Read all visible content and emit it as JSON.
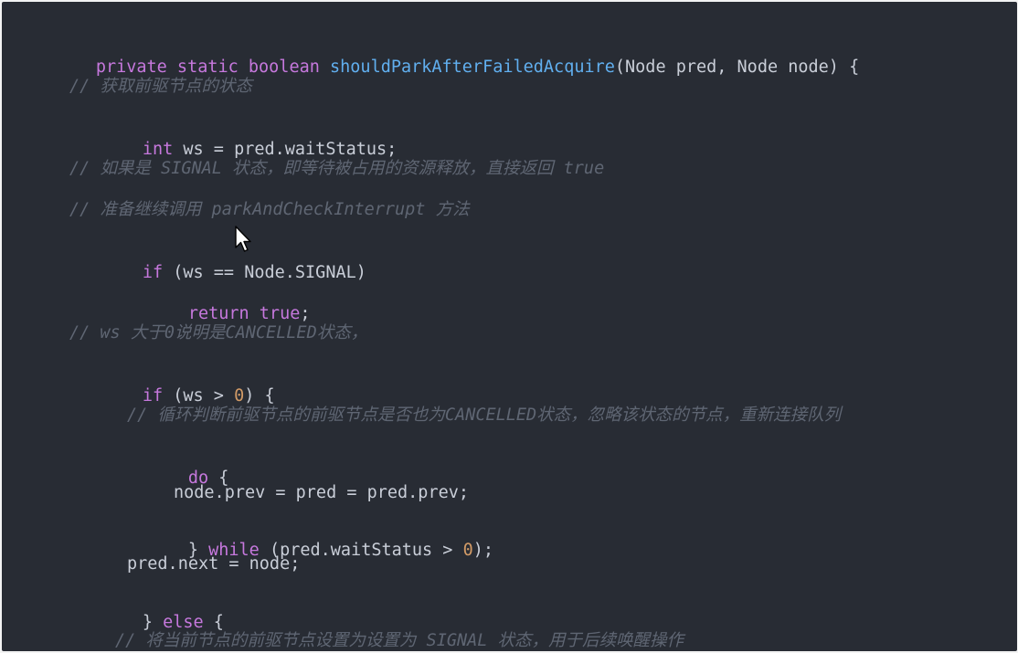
{
  "colors": {
    "background": "#282c34",
    "keyword": "#c678dd",
    "function": "#61afef",
    "number": "#d19a66",
    "comment": "#5f6673",
    "text": "#c9ced8"
  },
  "code": {
    "l1": {
      "kw": "private static boolean",
      "fn": "shouldParkAfterFailedAcquire",
      "rest": "(Node pred, Node node) {"
    },
    "l2": "// 获取前驱节点的状态",
    "l3": {
      "kw": "int",
      "rest": " ws = pred.waitStatus;"
    },
    "l4": "// 如果是 SIGNAL 状态，即等待被占用的资源释放，直接返回 true",
    "l5": "// 准备继续调用 parkAndCheckInterrupt 方法",
    "l6": {
      "kw": "if",
      "rest": " (ws == Node.SIGNAL)"
    },
    "l7": {
      "kw1": "return",
      "kw2": "true",
      "rest": ";"
    },
    "l8": "// ws 大于0说明是CANCELLED状态，",
    "l9": {
      "kw": "if",
      "a": " (ws > ",
      "num": "0",
      "b": ") {"
    },
    "l10": "// 循环判断前驱节点的前驱节点是否也为CANCELLED状态，忽略该状态的节点，重新连接队列",
    "l11": {
      "kw": "do",
      "rest": " {"
    },
    "l12": "node.prev = pred = pred.prev;",
    "l13": {
      "a": "} ",
      "kw": "while",
      "b": " (pred.waitStatus > ",
      "num": "0",
      "c": ");"
    },
    "l14": "pred.next = node;",
    "l15": {
      "a": "} ",
      "kw": "else",
      "b": " {"
    },
    "l16": "// 将当前节点的前驱节点设置为设置为 SIGNAL 状态，用于后续唤醒操作"
  }
}
